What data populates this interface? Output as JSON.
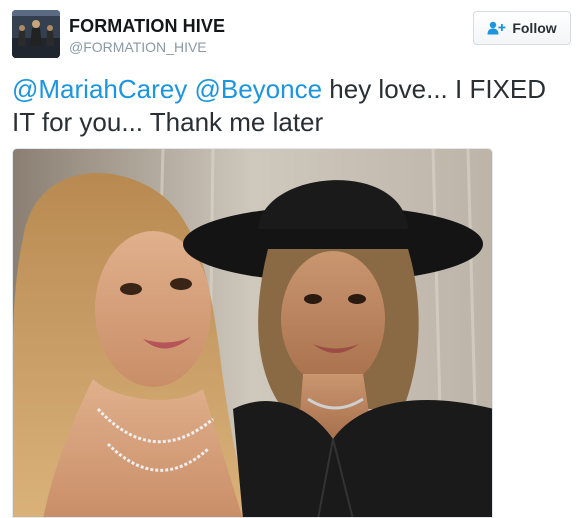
{
  "account": {
    "display_name": "FORMATION HIVE",
    "handle": "@FORMATION_HIVE"
  },
  "follow": {
    "label": "Follow",
    "icon": "add-user-icon"
  },
  "tweet": {
    "mention_1": "@MariahCarey",
    "mention_2": "@Beyonce",
    "text_line": " hey love... I FIXED IT for you... Thank me later"
  },
  "colors": {
    "link": "#1b95e0",
    "text": "#292f33",
    "secondary": "#8899a6"
  }
}
